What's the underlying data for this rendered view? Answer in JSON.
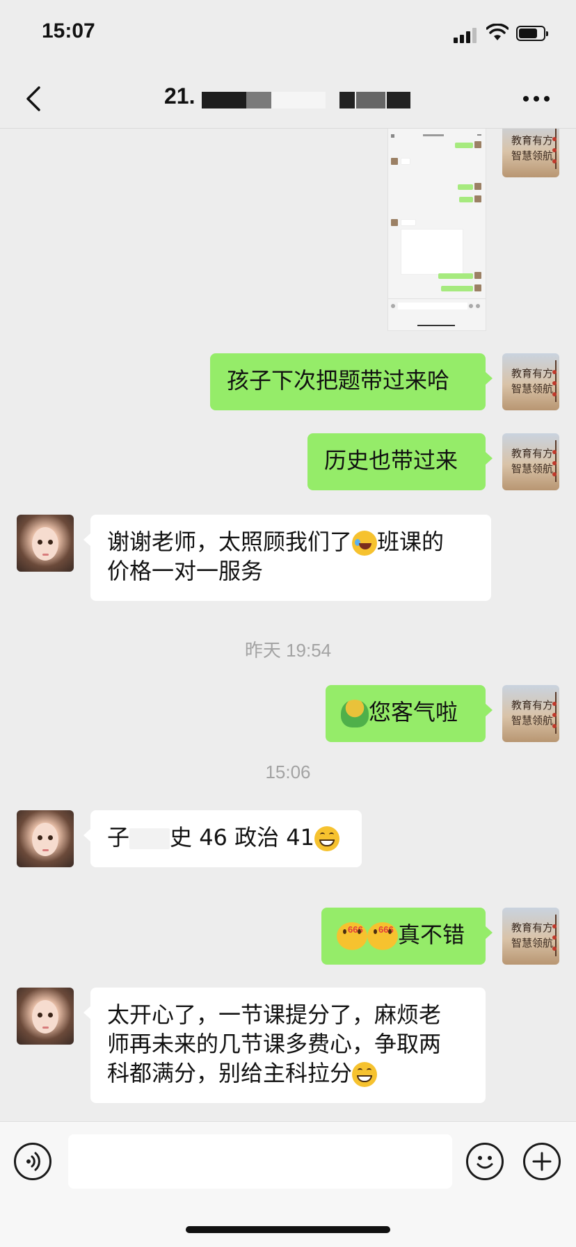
{
  "status_bar": {
    "time": "15:07",
    "battery_level": 0.75
  },
  "nav": {
    "title": "21.",
    "back_icon": "chevron-left-icon",
    "more_icon": "ellipsis-icon"
  },
  "messages": [
    {
      "side": "right",
      "type": "image",
      "description_icon": "chat-screenshot-thumbnail"
    },
    {
      "side": "right",
      "type": "text",
      "text": "孩子下次把题带过来哈"
    },
    {
      "side": "right",
      "type": "text",
      "text": "历史也带过来"
    },
    {
      "side": "left",
      "type": "text",
      "text_line1_a": "谢谢老师，太照顾我们了",
      "text_line1_b": "班课的",
      "text_line2": "价格一对一服务",
      "emoji": "laughing-crying-emoji"
    },
    {
      "type": "timestamp",
      "text": "昨天 19:54"
    },
    {
      "side": "right",
      "type": "text",
      "text": "您客气啦",
      "emoji": "green-figure-emoji"
    },
    {
      "type": "timestamp",
      "text": "15:06"
    },
    {
      "side": "left",
      "type": "text",
      "text_a": "子",
      "text_b": "史 46 政治 41",
      "emoji": "grinning-emoji"
    },
    {
      "side": "right",
      "type": "text",
      "text": "真不错",
      "emoji": "666-emoji",
      "emoji_label": "666"
    },
    {
      "side": "left",
      "type": "text",
      "text_line1": "太开心了，一节课提分了，麻烦老",
      "text_line2": "师再未来的几节课多费心，争取两",
      "text_line3": "科都满分，别给主科拉分",
      "emoji": "grinning-emoji"
    }
  ],
  "input_bar": {
    "voice_icon": "voice-icon",
    "emoji_icon": "emoji-face-icon",
    "plus_icon": "plus-icon",
    "input_value": ""
  },
  "colors": {
    "background": "#ededed",
    "bubble_right": "#95ec69",
    "bubble_left": "#ffffff",
    "timestamp": "#a3a3a3"
  }
}
